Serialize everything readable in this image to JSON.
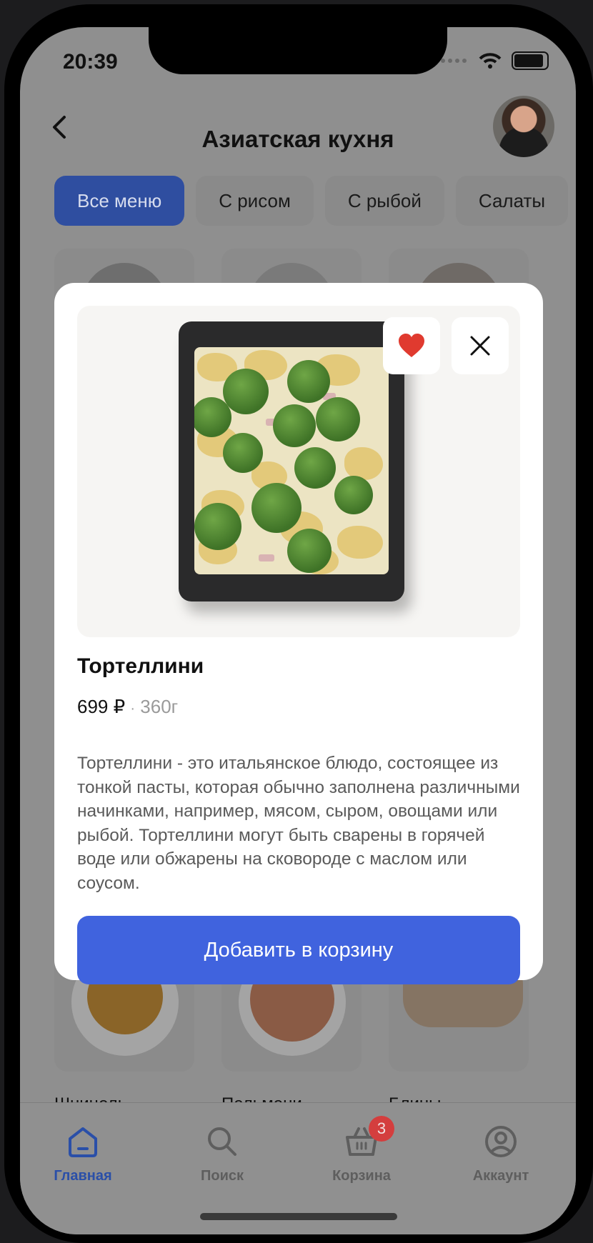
{
  "status": {
    "time": "20:39"
  },
  "header": {
    "title": "Азиатская кухня"
  },
  "chips": [
    "Все меню",
    "С рисом",
    "С рыбой",
    "Салаты"
  ],
  "grid": {
    "bottom_cards": [
      {
        "name": "Шницель"
      },
      {
        "name": "Пельмени"
      },
      {
        "name": "Блины"
      }
    ]
  },
  "modal": {
    "title": "Тортеллини",
    "price": "699 ₽",
    "separator": "·",
    "weight": "360г",
    "description": "Тортеллини - это итальянское блюдо, состоящее из тонкой пасты, которая обычно заполнена различными начинками, например, мясом, сыром, овощами или рыбой. Тортеллини могут быть сварены в горячей воде или обжарены на сковороде с маслом или соусом.",
    "add_button": "Добавить в корзину"
  },
  "tabbar": {
    "tabs": [
      {
        "label": "Главная",
        "icon": "home-icon",
        "active": true
      },
      {
        "label": "Поиск",
        "icon": "search-icon"
      },
      {
        "label": "Корзина",
        "icon": "basket-icon",
        "badge": "3"
      },
      {
        "label": "Аккаунт",
        "icon": "account-icon"
      }
    ]
  },
  "colors": {
    "accent": "#4063de",
    "active_tab": "#2a4fa8",
    "badge": "#d43e3e",
    "favorite": "#e03a2f"
  }
}
